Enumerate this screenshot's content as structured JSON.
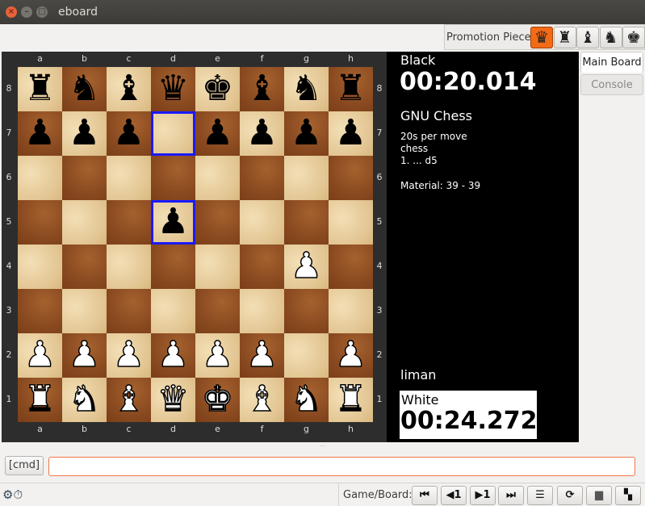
{
  "window": {
    "title": "eboard"
  },
  "promotion": {
    "label": "Promotion Piece",
    "pieces": [
      {
        "name": "queen",
        "glyph": "♛"
      },
      {
        "name": "rook",
        "glyph": "♜"
      },
      {
        "name": "bishop",
        "glyph": "♝"
      },
      {
        "name": "knight",
        "glyph": "♞"
      },
      {
        "name": "king",
        "glyph": "♚"
      }
    ],
    "selected": "queen",
    "accent": "#f36b16"
  },
  "board": {
    "files": [
      "a",
      "b",
      "c",
      "d",
      "e",
      "f",
      "g",
      "h"
    ],
    "ranks": [
      "8",
      "7",
      "6",
      "5",
      "4",
      "3",
      "2",
      "1"
    ],
    "position": [
      [
        "r",
        "n",
        "b",
        "q",
        "k",
        "b",
        "n",
        "r"
      ],
      [
        "p",
        "p",
        "p",
        "",
        "p",
        "p",
        "p",
        "p"
      ],
      [
        "",
        "",
        "",
        "",
        "",
        "",
        "",
        ""
      ],
      [
        "",
        "",
        "",
        "p",
        "",
        "",
        "",
        ""
      ],
      [
        "",
        "",
        "",
        "",
        "",
        "",
        "P",
        ""
      ],
      [
        "",
        "",
        "",
        "",
        "",
        "",
        "",
        ""
      ],
      [
        "P",
        "P",
        "P",
        "P",
        "P",
        "P",
        "",
        "P"
      ],
      [
        "R",
        "N",
        "B",
        "Q",
        "K",
        "B",
        "N",
        "R"
      ]
    ],
    "highlights": [
      "d7",
      "d5"
    ],
    "highlight_color": "#1a1aff"
  },
  "black": {
    "label": "Black",
    "clock": "00:20.014",
    "name": "GNU Chess"
  },
  "game": {
    "time_control": "20s per move",
    "variant": "chess",
    "last_move": "1. ... d5",
    "material": "Material: 39 - 39"
  },
  "white": {
    "name": "liman",
    "label": "White",
    "clock": "00:24.272"
  },
  "tabs": [
    {
      "label": "Main Board",
      "active": true
    },
    {
      "label": "Console",
      "active": false
    }
  ],
  "command": {
    "button": "[cmd]",
    "value": ""
  },
  "statusbar": {
    "label": "Game/Board:",
    "buttons": [
      {
        "name": "first",
        "text": "⏮"
      },
      {
        "name": "back",
        "text": "◀1"
      },
      {
        "name": "forward",
        "text": "▶1"
      },
      {
        "name": "last",
        "text": "⏭"
      }
    ]
  }
}
